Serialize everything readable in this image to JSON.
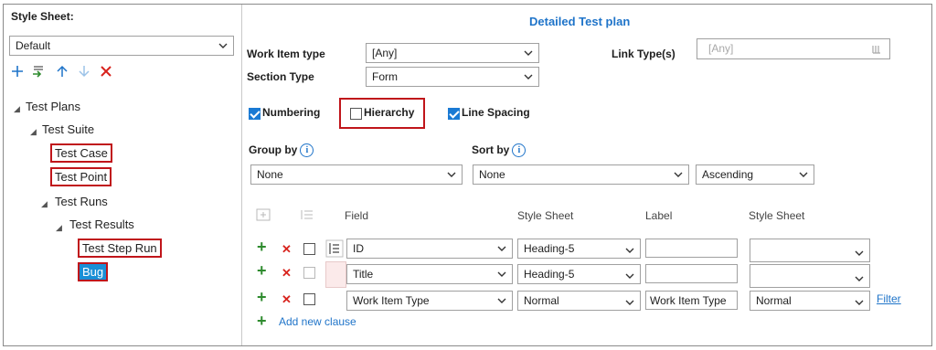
{
  "left": {
    "style_sheet_label": "Style Sheet:",
    "style_sheet_value": "Default",
    "toolbar": [
      "add-icon",
      "import-icon",
      "move-up-icon",
      "move-down-icon",
      "delete-icon"
    ],
    "tree": {
      "test_plans": "Test Plans",
      "test_suite": "Test Suite",
      "test_case": "Test Case",
      "test_point": "Test Point",
      "test_runs": "Test Runs",
      "test_results": "Test Results",
      "test_step_run": "Test Step Run",
      "bug": "Bug"
    }
  },
  "right": {
    "title": "Detailed Test plan",
    "work_item_type_label": "Work Item type",
    "work_item_type_value": "[Any]",
    "section_type_label": "Section Type",
    "section_type_value": "Form",
    "link_types_label": "Link Type(s)",
    "link_types_placeholder": "[Any]",
    "numbering_label": "Numbering",
    "hierarchy_label": "Hierarchy",
    "line_spacing_label": "Line Spacing",
    "group_by_label": "Group by",
    "group_by_value": "None",
    "sort_by_label": "Sort by",
    "sort_by_value": "None",
    "sort_order_value": "Ascending",
    "columns": {
      "field": "Field",
      "style_sheet": "Style Sheet",
      "label": "Label",
      "style_sheet2": "Style Sheet"
    },
    "rows": [
      {
        "field": "ID",
        "style": "Heading-5",
        "label": "",
        "style2": ""
      },
      {
        "field": "Title",
        "style": "Heading-5",
        "label": "",
        "style2": ""
      },
      {
        "field": "Work Item Type",
        "style": "Normal",
        "label": "Work Item Type",
        "style2": "Normal",
        "link": "Filter"
      }
    ],
    "add_clause": "Add new clause"
  },
  "colors": {
    "accent": "#1f74c9",
    "highlight_border": "#c0151a",
    "selected_bg": "#1a8fd6"
  }
}
